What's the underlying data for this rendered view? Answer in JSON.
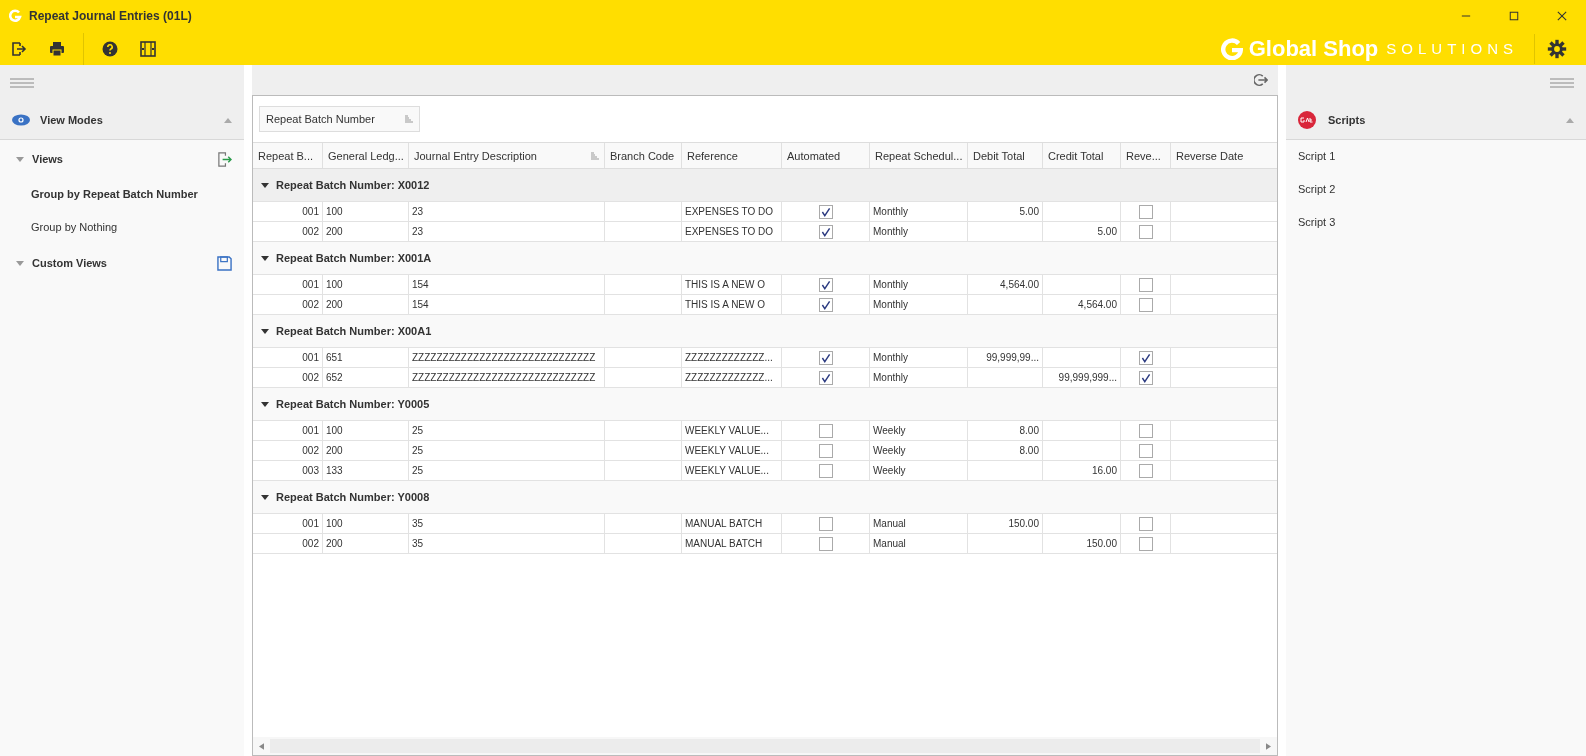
{
  "window": {
    "title": "Repeat Journal Entries (01L)"
  },
  "brand": {
    "name": "Global Shop",
    "tagline": "SOLUTIONS"
  },
  "left_panel": {
    "title": "View Modes",
    "expanded": true,
    "sections": [
      {
        "label": "Views",
        "expanded": true,
        "items": [
          {
            "label": "Group by Repeat Batch Number",
            "selected": true
          },
          {
            "label": "Group by Nothing",
            "selected": false
          }
        ]
      },
      {
        "label": "Custom Views",
        "expanded": true
      }
    ]
  },
  "group_panel": {
    "chip": "Repeat Batch Number"
  },
  "table": {
    "columns": [
      "Repeat B...",
      "General Ledg...",
      "Journal Entry Description",
      "Branch Code",
      "Reference",
      "Automated",
      "Repeat Schedul...",
      "Debit Total",
      "Credit Total",
      "Reve...",
      "Reverse Date"
    ],
    "groups": [
      {
        "label": "Repeat Batch Number: X0012",
        "expanded": true,
        "rows": [
          {
            "batch": "001",
            "gl": "100",
            "description": "23",
            "reference": "EXPENSES TO DO",
            "automated": true,
            "schedule": "Monthly",
            "debit": "5.00",
            "reverse": false
          },
          {
            "batch": "002",
            "gl": "200",
            "description": "23",
            "reference": "EXPENSES TO DO",
            "automated": true,
            "schedule": "Monthly",
            "credit": "5.00",
            "reverse": false
          }
        ]
      },
      {
        "label": "Repeat Batch Number: X001A",
        "expanded": true,
        "rows": [
          {
            "batch": "001",
            "gl": "100",
            "description": "154",
            "reference": "THIS IS A NEW O",
            "automated": true,
            "schedule": "Monthly",
            "debit": "4,564.00",
            "reverse": false
          },
          {
            "batch": "002",
            "gl": "200",
            "description": "154",
            "reference": "THIS IS A NEW O",
            "automated": true,
            "schedule": "Monthly",
            "credit": "4,564.00",
            "reverse": false
          }
        ]
      },
      {
        "label": "Repeat Batch Number: X00A1",
        "expanded": true,
        "rows": [
          {
            "batch": "001",
            "gl": "651",
            "description": "ZZZZZZZZZZZZZZZZZZZZZZZZZZZZZZ",
            "reference": "ZZZZZZZZZZZZZ...",
            "automated": true,
            "schedule": "Monthly",
            "debit": "99,999,99...",
            "reverse": true
          },
          {
            "batch": "002",
            "gl": "652",
            "description": "ZZZZZZZZZZZZZZZZZZZZZZZZZZZZZZ",
            "reference": "ZZZZZZZZZZZZZ...",
            "automated": true,
            "schedule": "Monthly",
            "credit": "99,999,999...",
            "reverse": true
          }
        ]
      },
      {
        "label": "Repeat Batch Number: Y0005",
        "expanded": true,
        "rows": [
          {
            "batch": "001",
            "gl": "100",
            "description": "25",
            "reference": "WEEKLY VALUE...",
            "automated": false,
            "schedule": "Weekly",
            "debit": "8.00",
            "reverse": false
          },
          {
            "batch": "002",
            "gl": "200",
            "description": "25",
            "reference": "WEEKLY VALUE...",
            "automated": false,
            "schedule": "Weekly",
            "debit": "8.00",
            "reverse": false
          },
          {
            "batch": "003",
            "gl": "133",
            "description": "25",
            "reference": "WEEKLY VALUE...",
            "automated": false,
            "schedule": "Weekly",
            "credit": "16.00",
            "reverse": false
          }
        ]
      },
      {
        "label": "Repeat Batch Number: Y0008",
        "expanded": true,
        "rows": [
          {
            "batch": "001",
            "gl": "100",
            "description": "35",
            "reference": "MANUAL BATCH",
            "automated": false,
            "schedule": "Manual",
            "debit": "150.00",
            "reverse": false
          },
          {
            "batch": "002",
            "gl": "200",
            "description": "35",
            "reference": "MANUAL BATCH",
            "automated": false,
            "schedule": "Manual",
            "credit": "150.00",
            "reverse": false
          }
        ]
      }
    ]
  },
  "right_panel": {
    "title": "Scripts",
    "expanded": true,
    "items": [
      "Script 1",
      "Script 2",
      "Script 3"
    ]
  }
}
